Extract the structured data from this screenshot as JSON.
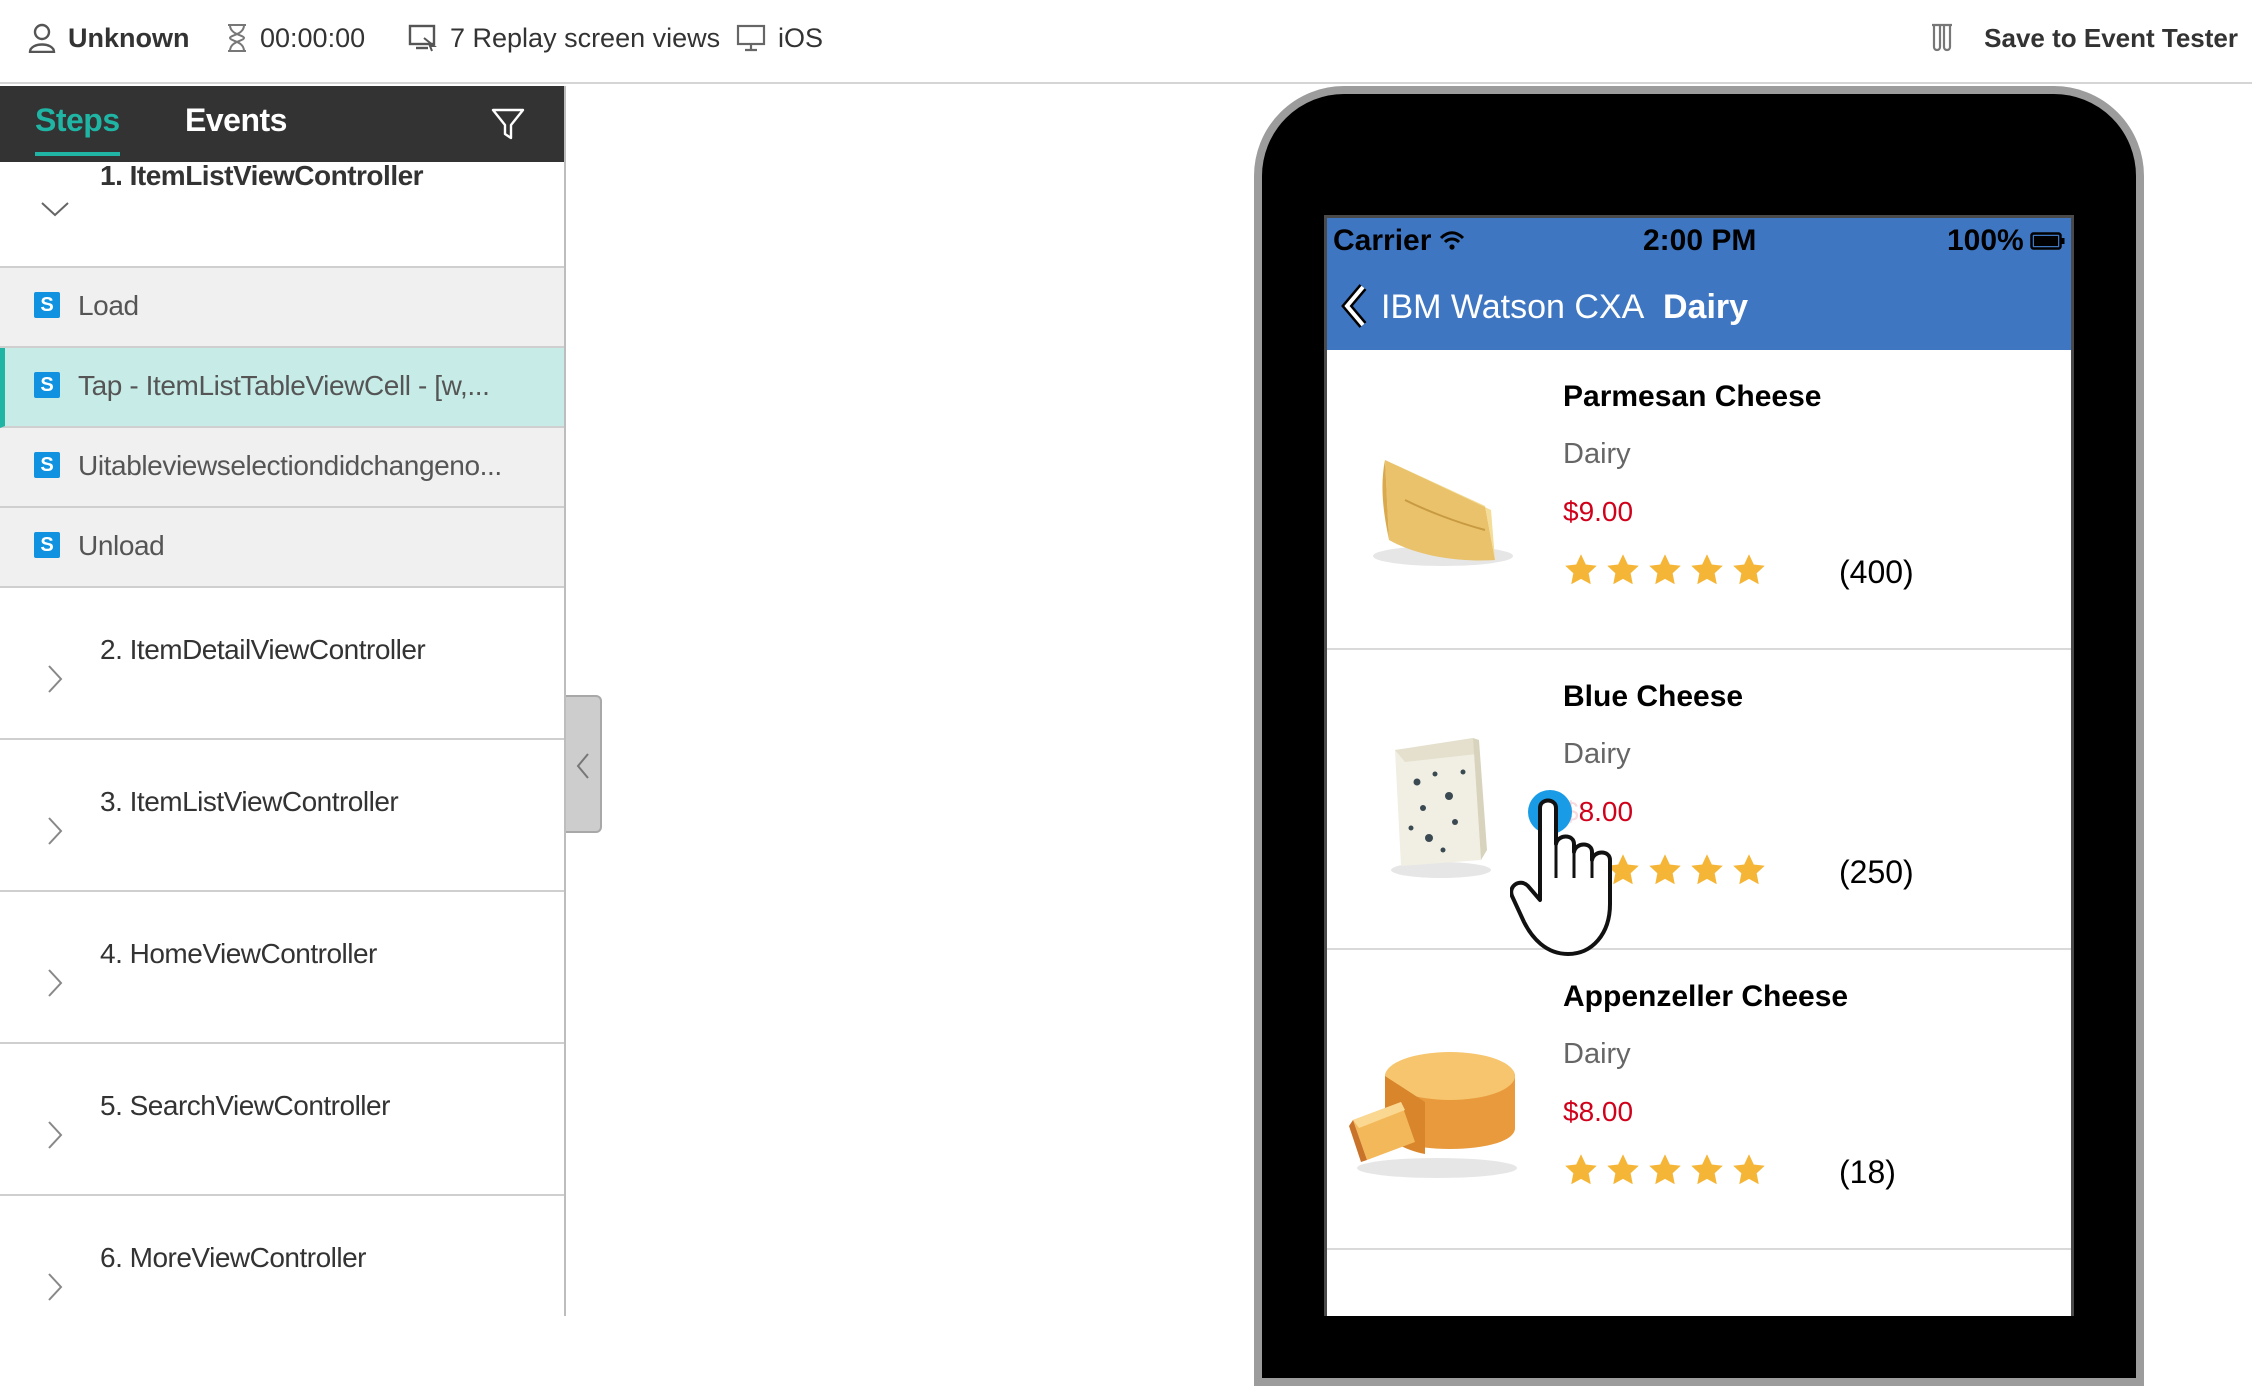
{
  "topbar": {
    "user": "Unknown",
    "duration": "00:00:00",
    "replay_views": "7 Replay screen views",
    "platform": "iOS",
    "save_label": "Save to Event Tester"
  },
  "sidebar": {
    "tab_steps": "Steps",
    "tab_events": "Events",
    "step1": {
      "title": "1. ItemListViewController",
      "events": [
        "Load",
        "Tap - ItemListTableViewCell - [w,...",
        "Uitableviewselectiondidchangeno...",
        "Unload"
      ],
      "badge": "S"
    },
    "steps": [
      "2. ItemDetailViewController",
      "3. ItemListViewController",
      "4. HomeViewController",
      "5. SearchViewController",
      "6. MoreViewController"
    ]
  },
  "phone": {
    "carrier": "Carrier",
    "time": "2:00 PM",
    "battery": "100%",
    "back_label": "IBM Watson CXA",
    "title": "Dairy",
    "products": [
      {
        "name": "Parmesan Cheese",
        "category": "Dairy",
        "price": "$9.00",
        "rating": 5,
        "count": "(400)"
      },
      {
        "name": "Blue Cheese",
        "category": "Dairy",
        "price": "$8.00",
        "rating": 5,
        "count": "(250)"
      },
      {
        "name": "Appenzeller Cheese",
        "category": "Dairy",
        "price": "$8.00",
        "rating": 5,
        "count": "(18)"
      }
    ]
  },
  "colors": {
    "accent_teal": "#1fb4a4",
    "tab_bar": "#333333",
    "ios_navbar": "#3f76c2",
    "price_red": "#d0021b",
    "star_gold": "#f5b637",
    "badge_blue": "#1192e0"
  }
}
